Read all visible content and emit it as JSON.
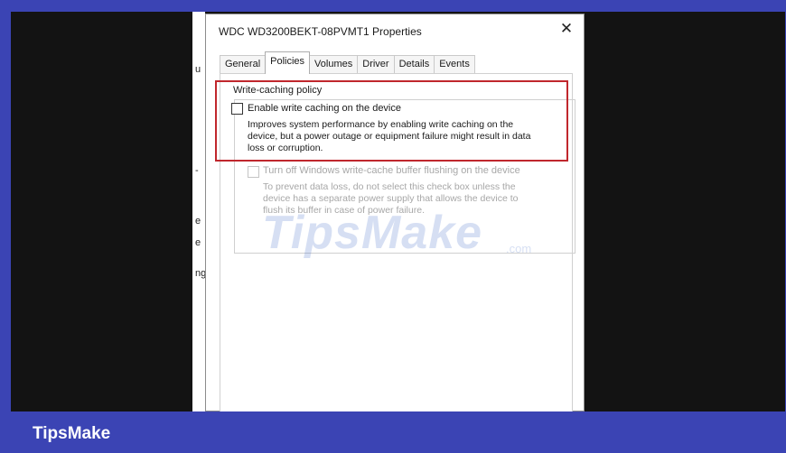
{
  "dialog": {
    "title": "WDC WD3200BEKT-08PVMT1 Properties",
    "close_glyph": "✕",
    "tabs": [
      "General",
      "Policies",
      "Volumes",
      "Driver",
      "Details",
      "Events"
    ],
    "active_tab": "Policies"
  },
  "background_window": {
    "fragments": [
      "u",
      "-",
      "e",
      "e",
      "ng"
    ]
  },
  "write_caching": {
    "group_title": "Write-caching policy",
    "enable_label": "Enable write caching on the device",
    "enable_checked": false,
    "enable_desc_lines": [
      "Improves system performance by enabling write caching on the",
      "device, but a power outage or equipment failure might result in data",
      "loss or corruption."
    ],
    "flush_label": "Turn off Windows write-cache buffer flushing on the device",
    "flush_checked": false,
    "flush_disabled": true,
    "flush_desc_lines": [
      "To prevent data loss, do not select this check box unless the",
      "device has a separate power supply that allows the device to",
      "flush its buffer in case of power failure."
    ]
  },
  "watermark": {
    "main": "TipsMake",
    "suffix": ".com"
  },
  "footer": {
    "brand": "TipsMake"
  },
  "colors": {
    "frame": "#3b44b4",
    "highlight": "#c0272d",
    "backdrop": "#131313"
  }
}
